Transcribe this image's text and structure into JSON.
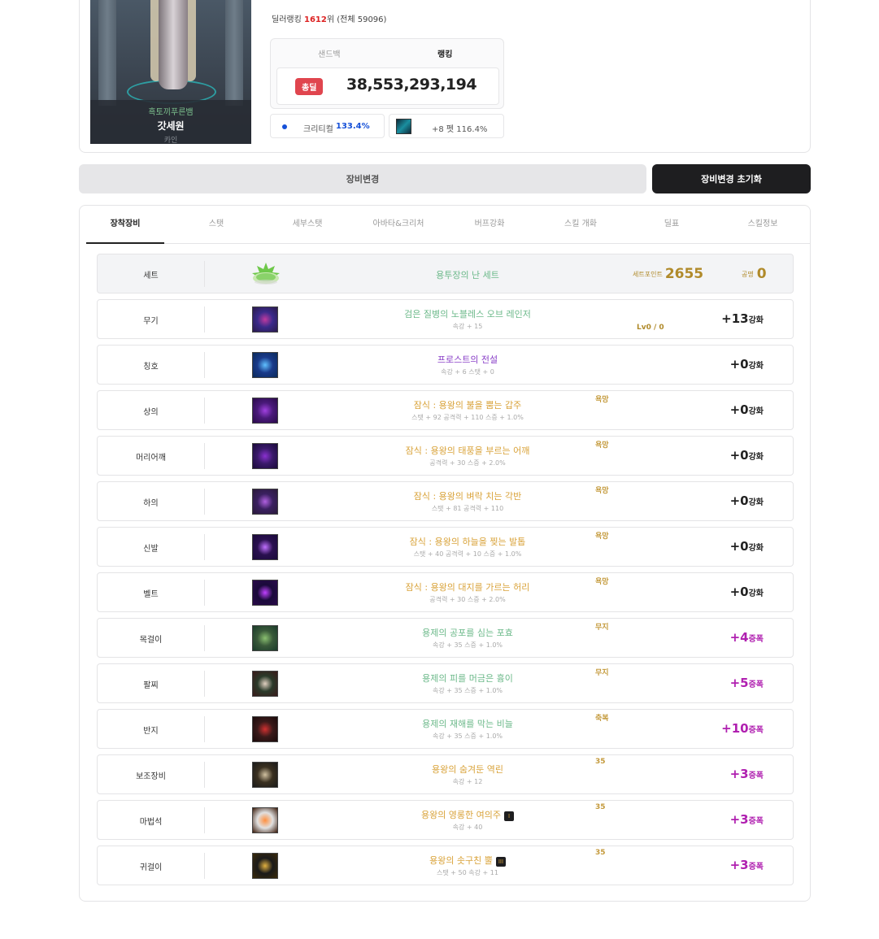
{
  "profile": {
    "adventure": "흑토끼푸른뱀",
    "name": "갓세원",
    "server": "카인"
  },
  "ranking": {
    "label": "딜러랭킹",
    "rank": "1612",
    "rank_suffix": "위",
    "total": "(전체 59096)"
  },
  "score": {
    "tab_sandbag": "샌드백",
    "tab_ranking": "랭킹",
    "badge": "총딜",
    "value": "38,553,293,194"
  },
  "chips": {
    "crit_label": "크리티컬",
    "crit_value": "133.4%",
    "pet_text": "+8 펫 116.4%"
  },
  "buttons": {
    "change": "장비변경",
    "reset": "장비변경 초기화"
  },
  "tabs": [
    "장착장비",
    "스탯",
    "세부스탯",
    "아바타&크리처",
    "버프강화",
    "스킬 개화",
    "딜표",
    "스킬정보"
  ],
  "set": {
    "slot": "세트",
    "name": "용투장의 난 세트",
    "point_label": "세트포인트",
    "point_value": "2655",
    "gj_label": "공명",
    "gj_value": "0"
  },
  "items": [
    {
      "slot": "무기",
      "name": "검은 질병의 노블레스 오브 레인저",
      "sub": "속강 + 15",
      "tag": "",
      "lv": "Lv0 / 0",
      "reinf": "+13",
      "reinf_unit": "강화",
      "color": "#6cb98a",
      "amp": false
    },
    {
      "slot": "칭호",
      "name": "프로스트의 전설",
      "sub": "속강 + 6 스탯 + 0",
      "tag": "",
      "lv": "",
      "reinf": "+0",
      "reinf_unit": "강화",
      "color": "#8a40c8",
      "amp": false
    },
    {
      "slot": "상의",
      "name": "잠식 : 용왕의 불을 뿜는 갑주",
      "sub": "스탯 + 92 공격력 + 110 스증 + 1.0%",
      "tag": "욕망",
      "lv": "",
      "reinf": "+0",
      "reinf_unit": "강화",
      "color": "#d9a33a",
      "amp": false
    },
    {
      "slot": "머리어깨",
      "name": "잠식 : 용왕의 태풍을 부르는 어깨",
      "sub": "공격력 + 30 스증 + 2.0%",
      "tag": "욕망",
      "lv": "",
      "reinf": "+0",
      "reinf_unit": "강화",
      "color": "#d9a33a",
      "amp": false
    },
    {
      "slot": "하의",
      "name": "잠식 : 용왕의 벼락 치는 각반",
      "sub": "스탯 + 81 공격력 + 110",
      "tag": "욕망",
      "lv": "",
      "reinf": "+0",
      "reinf_unit": "강화",
      "color": "#d9a33a",
      "amp": false
    },
    {
      "slot": "신발",
      "name": "잠식 : 용왕의 하늘을 찢는 발톱",
      "sub": "스탯 + 40 공격력 + 10 스증 + 1.0%",
      "tag": "욕망",
      "lv": "",
      "reinf": "+0",
      "reinf_unit": "강화",
      "color": "#d9a33a",
      "amp": false
    },
    {
      "slot": "벨트",
      "name": "잠식 : 용왕의 대지를 가르는 허리",
      "sub": "공격력 + 30 스증 + 2.0%",
      "tag": "욕망",
      "lv": "",
      "reinf": "+0",
      "reinf_unit": "강화",
      "color": "#d9a33a",
      "amp": false
    },
    {
      "slot": "목걸이",
      "name": "용제의 공포를 심는 포효",
      "sub": "속강 + 35 스증 + 1.0%",
      "tag": "무지",
      "lv": "",
      "reinf": "+4",
      "reinf_unit": "증폭",
      "color": "#6cb98a",
      "amp": true
    },
    {
      "slot": "팔찌",
      "name": "용제의 피를 머금은 흉이",
      "sub": "속강 + 35 스증 + 1.0%",
      "tag": "무지",
      "lv": "",
      "reinf": "+5",
      "reinf_unit": "증폭",
      "color": "#6cb98a",
      "amp": true
    },
    {
      "slot": "반지",
      "name": "용제의 재해를 막는 비늘",
      "sub": "속강 + 35 스증 + 1.0%",
      "tag": "축복",
      "lv": "",
      "reinf": "+10",
      "reinf_unit": "증폭",
      "color": "#6cb98a",
      "amp": true
    },
    {
      "slot": "보조장비",
      "name": "용왕의 숨겨둔 역린",
      "sub": "속강 + 12",
      "tag": "35",
      "lv": "",
      "reinf": "+3",
      "reinf_unit": "증폭",
      "color": "#d9a33a",
      "amp": true
    },
    {
      "slot": "마법석",
      "name": "용왕의 영롱한 여의주",
      "sub": "속강 + 40",
      "tag": "35",
      "lv": "",
      "rune": "I",
      "reinf": "+3",
      "reinf_unit": "증폭",
      "color": "#d9a33a",
      "amp": true
    },
    {
      "slot": "귀걸이",
      "name": "용왕의 솟구친 뿔",
      "sub": "스탯 + 50 속강 + 11",
      "tag": "35",
      "lv": "",
      "rune": "III",
      "reinf": "+3",
      "reinf_unit": "증폭",
      "color": "#d9a33a",
      "amp": true
    }
  ],
  "icon_names": [
    "weapon-icon",
    "title-icon",
    "top-icon",
    "shoulder-icon",
    "bottom-icon",
    "shoes-icon",
    "belt-icon",
    "necklace-icon",
    "bracelet-icon",
    "ring-icon",
    "subequip-icon",
    "magicstone-icon",
    "earring-icon"
  ],
  "icon_colors": [
    [
      "#2a1a4a",
      "#c03aa0",
      "#3a2a8a"
    ],
    [
      "#0a2a5a",
      "#60c0ff",
      "#1a3a8a"
    ],
    [
      "#2a0a4a",
      "#a040e0",
      "#4a1a7a"
    ],
    [
      "#1a0a3a",
      "#8a30d0",
      "#3a1a6a"
    ],
    [
      "#2a1a3a",
      "#b060e0",
      "#3a2060"
    ],
    [
      "#1a0a3a",
      "#c070ff",
      "#2a1050"
    ],
    [
      "#2a0a4a",
      "#c040ff",
      "#1a0a3a"
    ],
    [
      "#1a3a2a",
      "#8ac070",
      "#3a5a3a"
    ],
    [
      "#3a1a1a",
      "#e0d0c0",
      "#2a3a2a"
    ],
    [
      "#1a0a0a",
      "#d03030",
      "#3a1a1a"
    ],
    [
      "#1a1a1a",
      "#d0c0a0",
      "#3a3020"
    ],
    [
      "#3a1a0a",
      "#ff9040",
      "#e0e0e0"
    ],
    [
      "#3a2a0a",
      "#e0b040",
      "#1a1a1a"
    ]
  ]
}
